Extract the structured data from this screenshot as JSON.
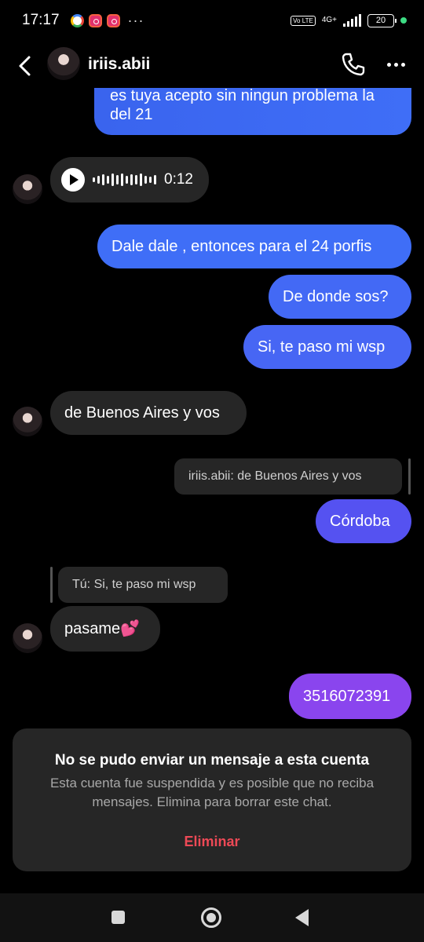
{
  "status_bar": {
    "time": "17:17",
    "more": "···",
    "volte": "Vo LTE",
    "network": "4G+",
    "battery": "20",
    "icons": [
      "google-icon",
      "instagram-icon",
      "instagram-icon"
    ]
  },
  "header": {
    "username": "iriis.abii",
    "back_icon": "chevron-left-icon",
    "call_icon": "phone-icon",
    "more_icon": "more-horizontal-icon"
  },
  "messages": {
    "m0_line1": "es tuya acepto sin ningun problema la",
    "m0_line2": "del 21",
    "voice_duration": "0:12",
    "m1": "Dale dale , entonces para el 24 porfis",
    "m2": "De donde sos?",
    "m3": "Si, te paso mi wsp",
    "m4": "de Buenos Aires y vos",
    "reply1": "iriis.abii: de Buenos Aires y vos",
    "m5": "Córdoba",
    "reply2": "Tú: Si, te paso mi wsp",
    "m6": "pasame💕",
    "m7": "3516072391"
  },
  "notice": {
    "title": "No se pudo enviar un mensaje a esta cuenta",
    "body": "Esta cuenta fue suspendida y es posible que no reciba mensajes. Elimina para borrar este chat.",
    "delete_label": "Eliminar"
  },
  "colors": {
    "bubble_blue": "#3f6ef7",
    "bubble_indigo": "#4a56f2",
    "bubble_violet": "#6a4cf0",
    "bubble_purple": "#8a45ee",
    "incoming": "#262626",
    "danger": "#ed4956"
  }
}
